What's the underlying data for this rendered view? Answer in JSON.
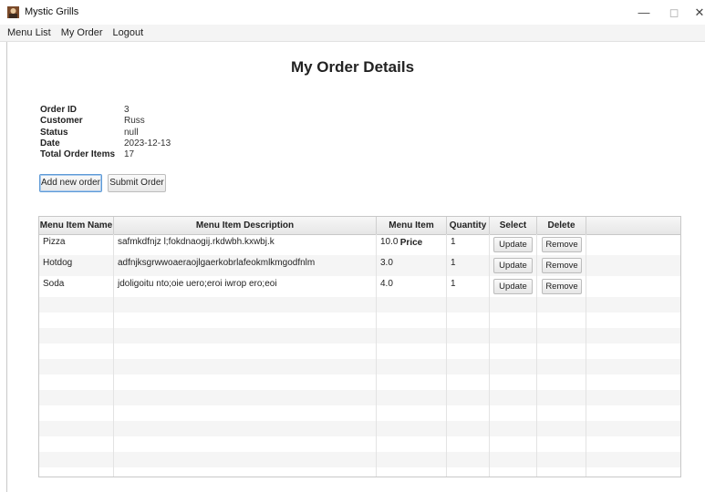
{
  "window": {
    "title": "Mystic Grills"
  },
  "menubar": {
    "items": [
      "Menu List",
      "My Order",
      "Logout"
    ]
  },
  "page": {
    "title": "My Order Details"
  },
  "order": {
    "labels": {
      "id": "Order ID",
      "customer": "Customer",
      "status": "Status",
      "date": "Date",
      "total": "Total Order Items"
    },
    "values": {
      "id": "3",
      "customer": "Russ",
      "status": "null",
      "date": "2023-12-13",
      "total": "17"
    }
  },
  "actions": {
    "add_label": "Add new order",
    "submit_label": "Submit Order"
  },
  "table": {
    "columns": [
      "Menu Item Name",
      "Menu Item Description",
      "Menu Item Price",
      "Quantity",
      "Select",
      "Delete"
    ],
    "rows": [
      {
        "name": "Pizza",
        "description": "safmkdfnjz l;fokdnaogij.rkdwbh.kxwbj.k",
        "price": "10.0",
        "quantity": "1",
        "select": "Update",
        "delete": "Remove"
      },
      {
        "name": "Hotdog",
        "description": "adfnjksgrwwoaeraojlgaerkobrlafeokmlkmgodfnlm",
        "price": "3.0",
        "quantity": "1",
        "select": "Update",
        "delete": "Remove"
      },
      {
        "name": "Soda",
        "description": "jdoligoitu nto;oie uero;eroi iwrop ero;eoi",
        "price": "4.0",
        "quantity": "1",
        "select": "Update",
        "delete": "Remove"
      }
    ]
  },
  "icons": {
    "app": "app-logo-icon",
    "minimize": "minimize-icon",
    "maximize": "maximize-icon",
    "close": "close-icon"
  }
}
